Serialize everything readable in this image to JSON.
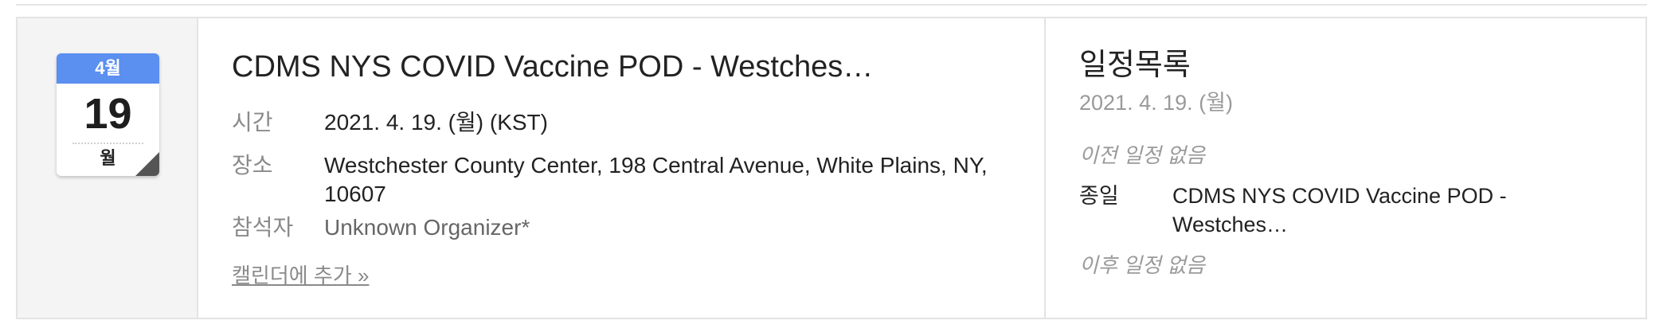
{
  "calendar": {
    "month": "4월",
    "day": "19",
    "weekday": "월"
  },
  "event": {
    "title": "CDMS NYS COVID Vaccine POD - Westches…",
    "time_label": "시간",
    "time_value": "2021. 4. 19. (월) (KST)",
    "place_label": "장소",
    "place_value": "Westchester County Center, 198 Central Avenue, White Plains, NY, 10607",
    "attendee_label": "참석자",
    "attendee_value": "Unknown Organizer*",
    "add_to_calendar": "캘린더에 추가 »"
  },
  "schedule": {
    "title": "일정목록",
    "date": "2021. 4. 19. (월)",
    "no_previous": "이전 일정 없음",
    "item_label": "종일",
    "item_title": "CDMS NYS COVID Vaccine POD - Westches…",
    "no_next": "이후 일정 없음"
  }
}
